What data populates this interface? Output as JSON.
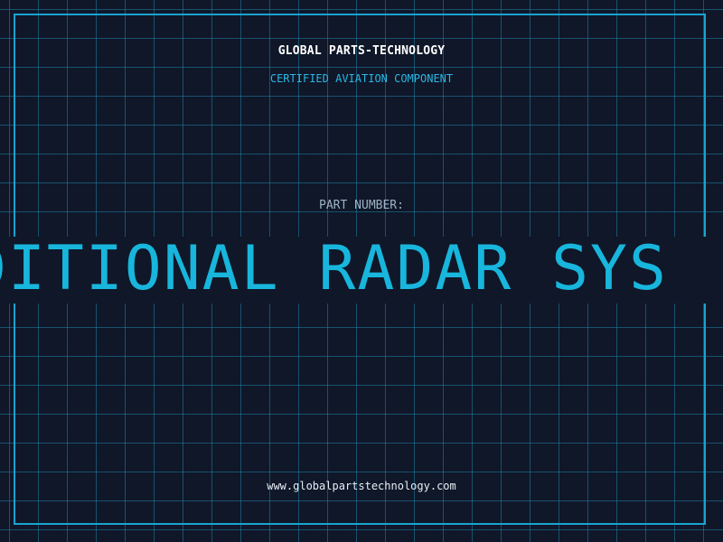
{
  "header": {
    "company": "GLOBAL PARTS-TECHNOLOGY",
    "tagline": "CERTIFIED AVIATION COMPONENT"
  },
  "part": {
    "label": "PART NUMBER:",
    "value": "DITIONAL RADAR SYS"
  },
  "footer": {
    "website": "www.globalpartstechnology.com"
  },
  "colors": {
    "background": "#0f1729",
    "grid": "#2082a5",
    "frame": "#1aa3cf",
    "accent": "#18b6dc",
    "text": "#ffffff",
    "label": "#9fb3c6"
  }
}
